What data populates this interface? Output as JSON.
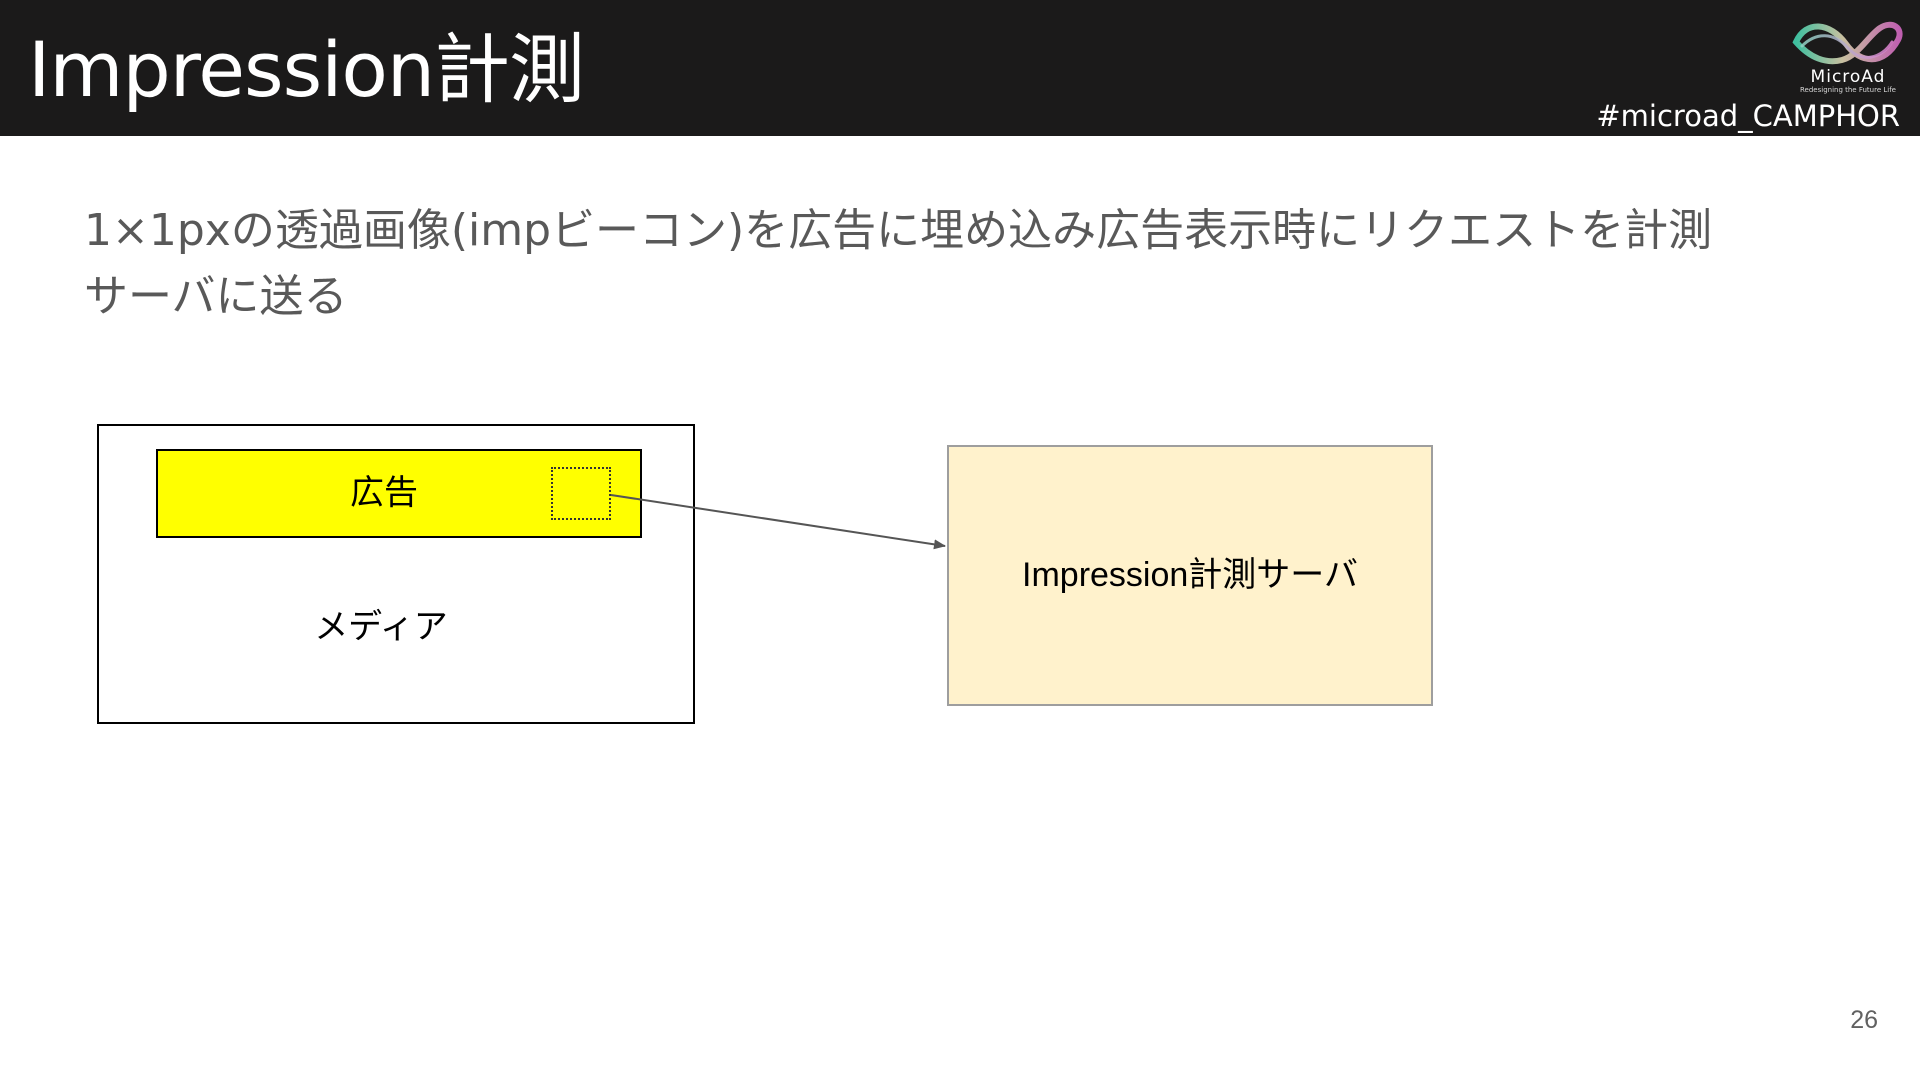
{
  "header": {
    "title": "Impression計測",
    "hashtag": "#microad_CAMPHOR",
    "logo": {
      "name": "MicroAd",
      "tagline": "Redesigning the Future Life",
      "icon": "microad-infinity-logo-icon"
    }
  },
  "body": {
    "line1": "1×1pxの透過画像(impビーコン)を広告に埋め込み広告表示時にリクエストを計測",
    "line2": "サーバに送る"
  },
  "diagram": {
    "media_label": "メディア",
    "ad_label": "広告",
    "server_label": "Impression計測サーバ",
    "colors": {
      "ad_fill": "#ffff00",
      "server_fill": "#fff2cc",
      "server_border": "#9e9e9e",
      "arrow": "#555555"
    }
  },
  "footer": {
    "page_number": "26"
  }
}
